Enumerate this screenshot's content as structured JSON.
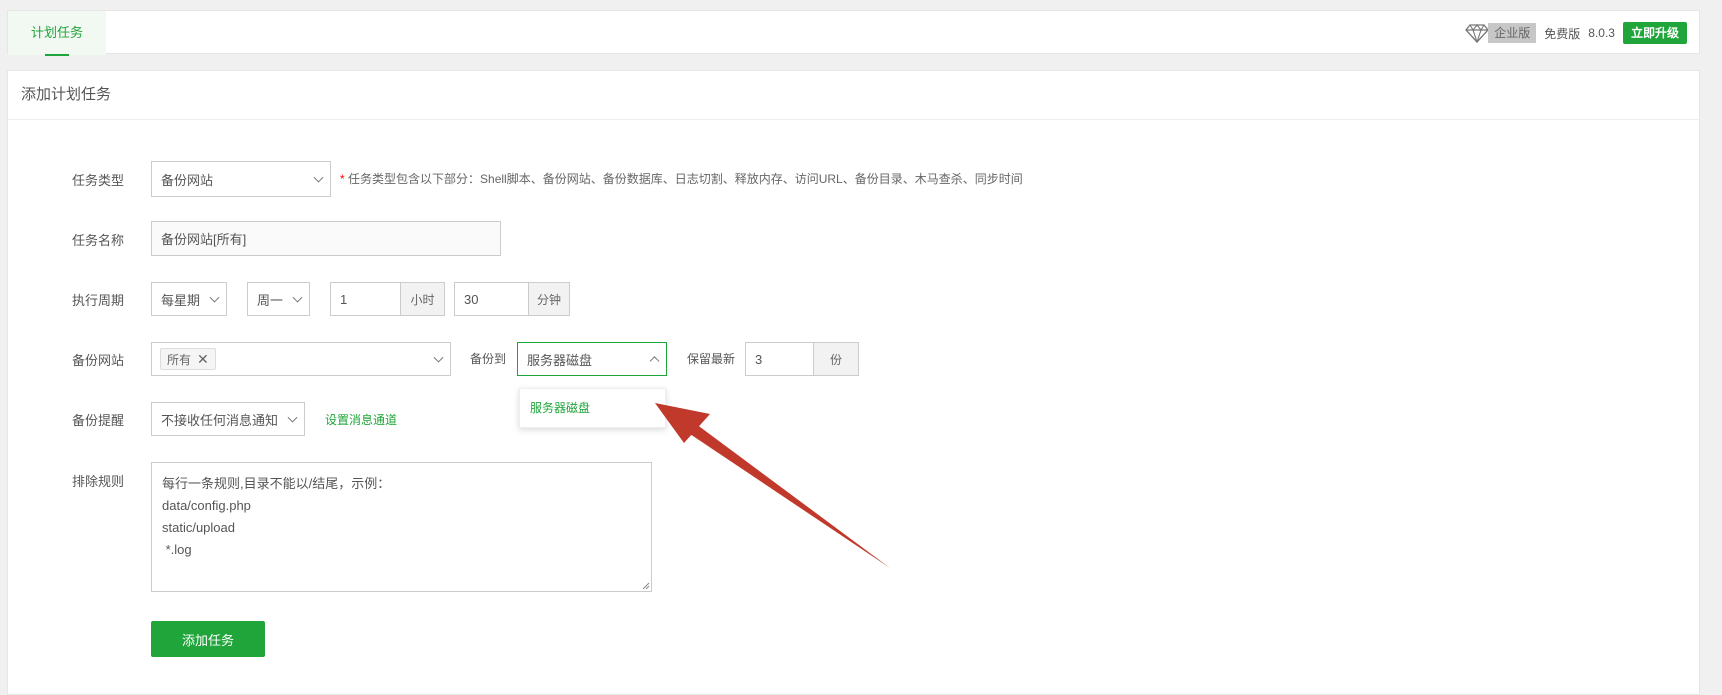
{
  "tabs": {
    "active_label": "计划任务"
  },
  "header": {
    "enterprise_badge": "企业版",
    "free_label": "免费版",
    "version": "8.0.3",
    "upgrade_label": "立即升级"
  },
  "panel": {
    "title": "添加计划任务"
  },
  "form": {
    "task_type": {
      "label": "任务类型",
      "value": "备份网站",
      "hint_star": "*",
      "hint": "任务类型包含以下部分：Shell脚本、备份网站、备份数据库、日志切割、释放内存、访问URL、备份目录、木马查杀、同步时间"
    },
    "task_name": {
      "label": "任务名称",
      "value": "备份网站[所有]"
    },
    "period": {
      "label": "执行周期",
      "cycle": "每星期",
      "weekday": "周一",
      "hour": "1",
      "hour_unit": "小时",
      "minute": "30",
      "minute_unit": "分钟"
    },
    "backup_site": {
      "label": "备份网站",
      "tag": "所有",
      "tag_remove": "✕",
      "backup_to_label": "备份到",
      "backup_to_value": "服务器磁盘",
      "dropdown_option": "服务器磁盘",
      "keep_label": "保留最新",
      "keep_value": "3",
      "keep_unit": "份"
    },
    "notify": {
      "label": "备份提醒",
      "value": "不接收任何消息通知",
      "link": "设置消息通道"
    },
    "exclude": {
      "label": "排除规则",
      "lines": [
        "每行一条规则,目录不能以/结尾，示例：",
        "data/config.php",
        "static/upload",
        " *.log"
      ]
    },
    "submit_label": "添加任务"
  },
  "colors": {
    "accent": "#20a53a",
    "arrow": "#c0392b"
  },
  "icons": {
    "diamond": "diamond-icon"
  }
}
